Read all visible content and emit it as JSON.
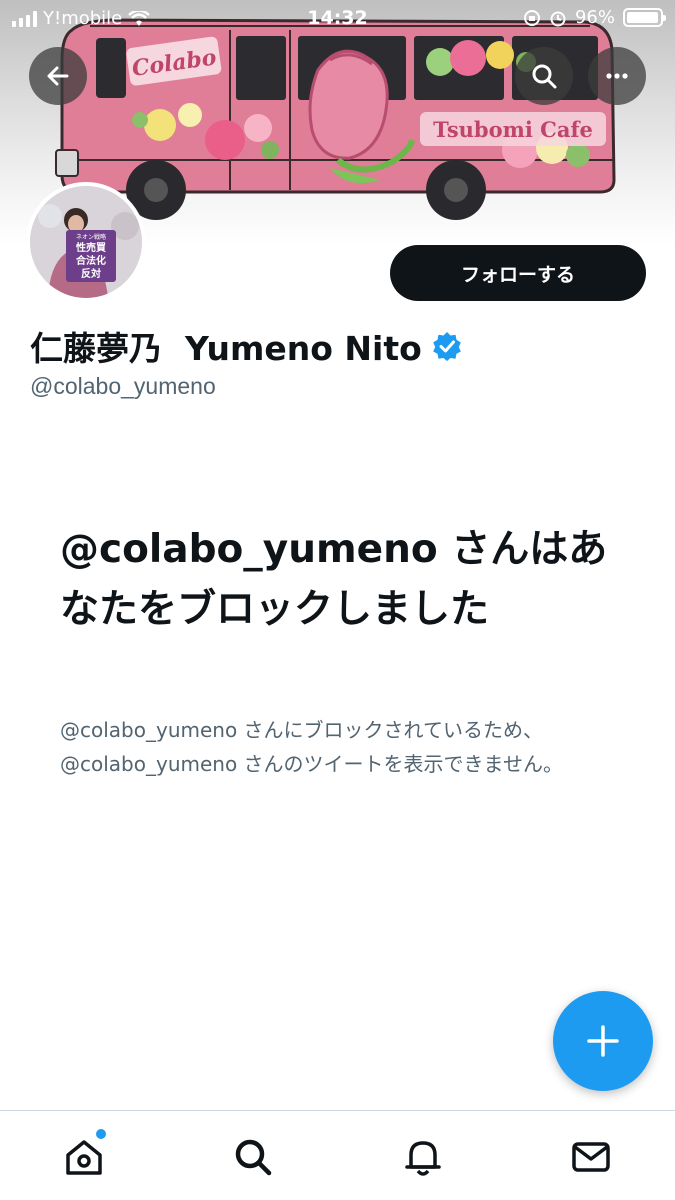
{
  "status_bar": {
    "carrier": "Y!mobile",
    "time": "14:32",
    "battery": "96%",
    "battery_level": 0.96
  },
  "banner": {
    "bus_logo_text": "Colabo",
    "cafe_text": "Tsubomi Cafe"
  },
  "avatar": {
    "sign_small": "ネオン戦略",
    "sign_lines": [
      "性売買",
      "合法化",
      "反対"
    ]
  },
  "header": {
    "back_icon": "back-arrow-icon",
    "search_icon": "search-icon",
    "more_icon": "more-icon"
  },
  "profile": {
    "name": "仁藤夢乃  Yumeno Nito",
    "handle": "@colabo_yumeno",
    "verified": true,
    "follow_label": "フォローする"
  },
  "blocked": {
    "title": "@colabo_yumeno さんはあなたをブロックしました",
    "description": "@colabo_yumeno さんにブロックされているため、@colabo_yumeno さんのツイートを表示できません。"
  },
  "fab_icon": "plus-icon",
  "tabbar": {
    "items": [
      "home-icon",
      "search-icon",
      "notifications-icon",
      "messages-icon"
    ],
    "home_has_unread": true
  },
  "colors": {
    "accent": "#1d9bf0",
    "text_primary": "#0f1419",
    "text_secondary": "#536471",
    "bus_pink": "#e07d97"
  }
}
